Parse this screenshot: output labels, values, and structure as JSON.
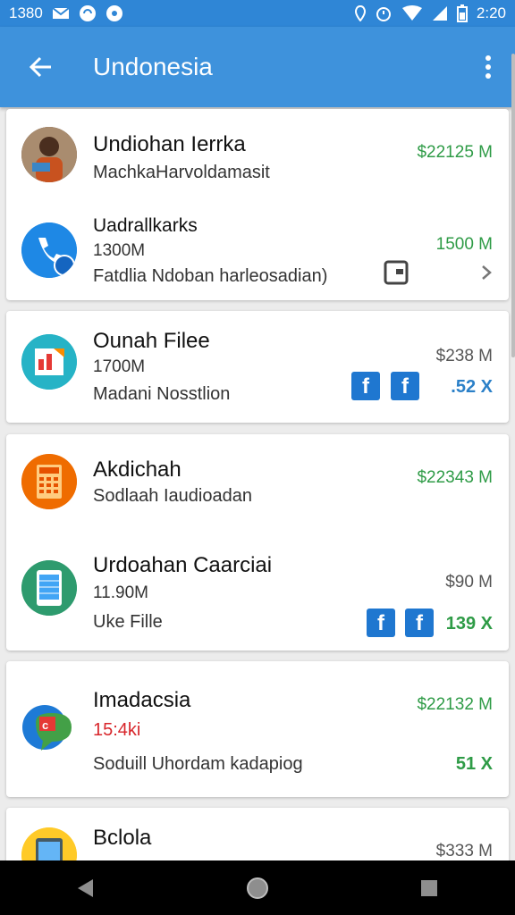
{
  "status_bar": {
    "time_left": "1380",
    "time_right": "2:20"
  },
  "app_bar": {
    "title": "Undonesia"
  },
  "items": [
    {
      "title": "Undiohan Ierrka",
      "line1": "MachkaHarvoldamasit",
      "amount": "$22125 M"
    },
    {
      "title": "Uadrallkarks",
      "line1": "1300M",
      "line2": "Fatdlia Ndoban harleosadian)",
      "amount": "1500 M"
    },
    {
      "title": "Ounah Filee",
      "line1": "1700M",
      "line2": "Madani Nosstlion",
      "amount": "$238 M",
      "trail": ".52 X"
    },
    {
      "title": "Akdichah",
      "line1": "Sodlaah Iaudioadan",
      "amount": "$22343 M"
    },
    {
      "title": "Urdoahan Caarciai",
      "line1": "11.90M",
      "line2": "Uke Fille",
      "amount": "$90 M",
      "trail": "139 X"
    },
    {
      "title": "Imadacsia",
      "line1": "15:4ki",
      "line2": "Soduill Uhordam kadapiog",
      "amount": "$22132 M",
      "trail": "51 X"
    },
    {
      "title": "Bclola",
      "amount": "$333 M"
    }
  ],
  "colors": {
    "app_bar": "#3e92dc",
    "status_bar": "#2f86d6",
    "positive": "#2e9b46",
    "facebook": "#1f77d0",
    "negative": "#d8262b"
  },
  "icons": [
    "arrow-left-icon",
    "more-vert-icon",
    "phone-icon",
    "chevron-right-icon",
    "calendar-icon",
    "facebook-icon",
    "back-triangle-icon",
    "home-circle-icon",
    "recents-square-icon"
  ]
}
